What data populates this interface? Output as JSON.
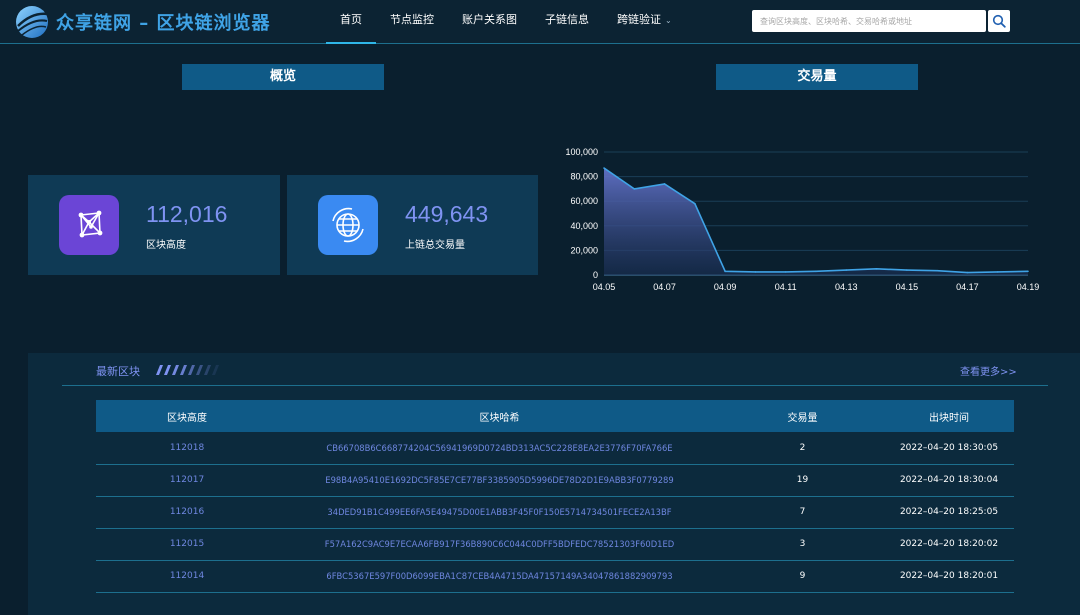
{
  "header": {
    "brand": "众享链网 – 区块链浏览器",
    "nav": [
      {
        "label": "首页"
      },
      {
        "label": "节点监控"
      },
      {
        "label": "账户关系图"
      },
      {
        "label": "子链信息"
      },
      {
        "label": "跨链验证"
      }
    ],
    "search_placeholder": "查询区块高度、区块哈希、交易哈希或地址"
  },
  "overview": {
    "title": "概览",
    "cards": [
      {
        "value": "112,016",
        "label": "区块高度",
        "icon": "cube-network-icon",
        "color": "#6b45d6"
      },
      {
        "value": "449,643",
        "label": "上链总交易量",
        "icon": "globe-icon",
        "color": "#3a8af2"
      }
    ]
  },
  "volume": {
    "title": "交易量"
  },
  "chart_data": {
    "type": "area",
    "x": [
      "04.05",
      "04.06",
      "04.07",
      "04.08",
      "04.09",
      "04.10",
      "04.11",
      "04.12",
      "04.13",
      "04.14",
      "04.15",
      "04.16",
      "04.17",
      "04.18",
      "04.19"
    ],
    "values": [
      87000,
      70000,
      74000,
      58000,
      3000,
      2500,
      2500,
      3000,
      4000,
      5000,
      4000,
      3500,
      2000,
      2500,
      3000
    ],
    "xticks": [
      "04.05",
      "04.07",
      "04.09",
      "04.11",
      "04.13",
      "04.15",
      "04.17",
      "04.19"
    ],
    "yticks": [
      "0",
      "20,000",
      "40,000",
      "60,000",
      "80,000",
      "100,000"
    ],
    "ylim": [
      0,
      100000
    ],
    "grid": true,
    "color": "#3fa3e6"
  },
  "latest": {
    "title": "最新区块",
    "more": "查看更多>>",
    "columns": [
      "区块高度",
      "区块哈希",
      "交易量",
      "出块时间"
    ],
    "rows": [
      {
        "height": "112018",
        "hash": "CB66708B6C668774204C56941969D0724BD313AC5C228E8EA2E3776F70FA766E",
        "tx": "2",
        "time": "2022–04–20 18:30:05"
      },
      {
        "height": "112017",
        "hash": "E98B4A95410E1692DC5F85E7CE77BF3385905D5996DE78D2D1E9ABB3F0779289",
        "tx": "19",
        "time": "2022–04–20 18:30:04"
      },
      {
        "height": "112016",
        "hash": "34DED91B1C499EE6FA5E49475D00E1ABB3F45F0F150E5714734501FECE2A13BF",
        "tx": "7",
        "time": "2022–04–20 18:25:05"
      },
      {
        "height": "112015",
        "hash": "F57A162C9AC9E7ECAA6FB917F36B890C6C044C0DFF5BDFEDC78521303F60D1ED",
        "tx": "3",
        "time": "2022–04–20 18:20:02"
      },
      {
        "height": "112014",
        "hash": "6FBC5367E597F00D6099EBA1C87CEB4A4715DA47157149A34047861882909793",
        "tx": "9",
        "time": "2022–04–20 18:20:01"
      }
    ]
  }
}
